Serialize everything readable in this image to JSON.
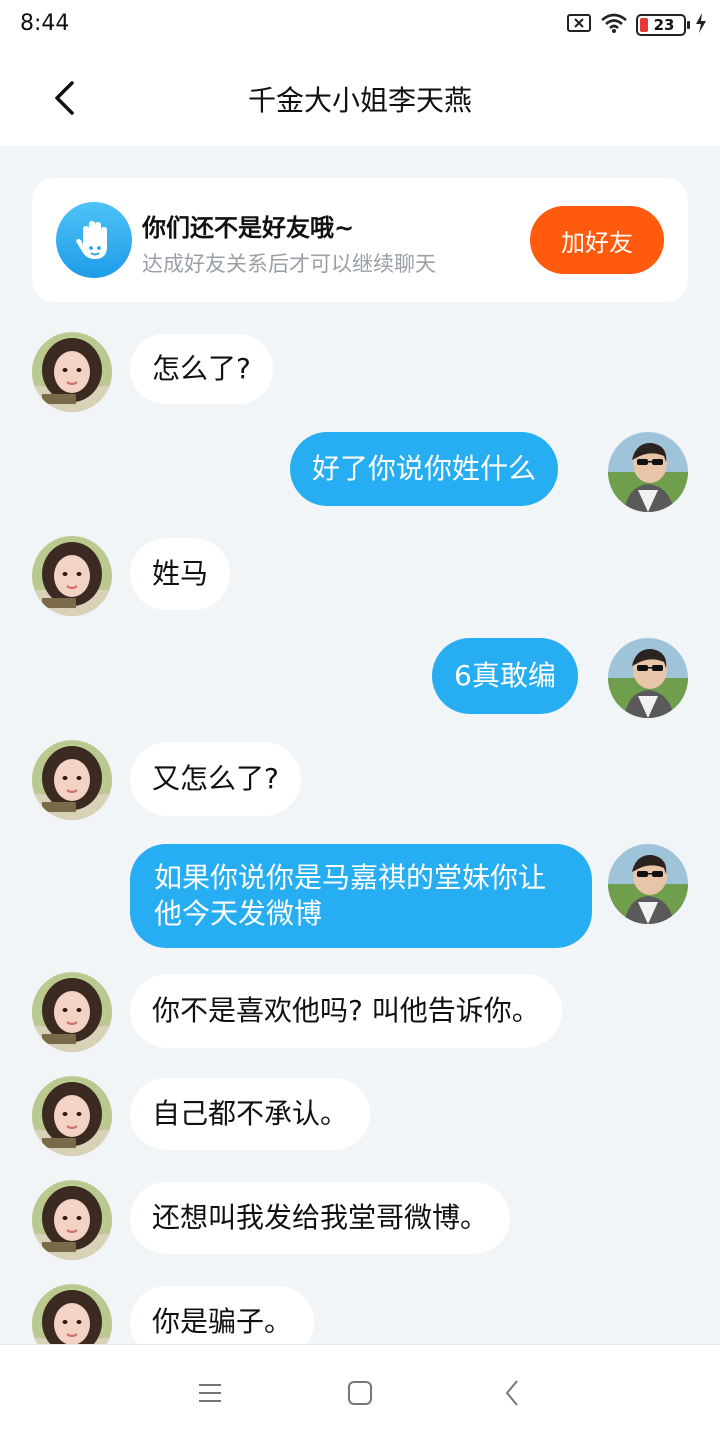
{
  "status_bar": {
    "time": "8:44",
    "battery_level": "23",
    "icons": [
      "sim-disabled-icon",
      "wifi-icon",
      "battery-icon",
      "charging-icon"
    ]
  },
  "header": {
    "title": "千金大小姐李天燕",
    "back_icon": "chevron-left-icon"
  },
  "friend_prompt": {
    "title": "你们还不是好友哦~",
    "subtitle": "达成好友关系后才可以继续聊天",
    "button_label": "加好友",
    "icon": "waving-hand-icon",
    "button_color": "#ff5a0d"
  },
  "messages": [
    {
      "side": "in",
      "text": "怎么了?"
    },
    {
      "side": "out",
      "text": "好了你说你姓什么"
    },
    {
      "side": "in",
      "text": "姓马"
    },
    {
      "side": "out",
      "text": "6真敢编"
    },
    {
      "side": "in",
      "text": "又怎么了?"
    },
    {
      "side": "out",
      "text": "如果你说你是马嘉祺的堂妹你让他今天发微博"
    },
    {
      "side": "in",
      "text": "你不是喜欢他吗? 叫他告诉你。"
    },
    {
      "side": "in",
      "text": "自己都不承认。"
    },
    {
      "side": "in",
      "text": "还想叫我发给我堂哥微博。"
    },
    {
      "side": "in",
      "text": "你是骗子。"
    }
  ],
  "colors": {
    "outgoing_bubble": "#27aef2",
    "incoming_bubble": "#ffffff",
    "background": "#f2f5f7"
  },
  "nav_bar": {
    "icons": [
      "menu-icon",
      "home-icon",
      "back-icon"
    ]
  }
}
